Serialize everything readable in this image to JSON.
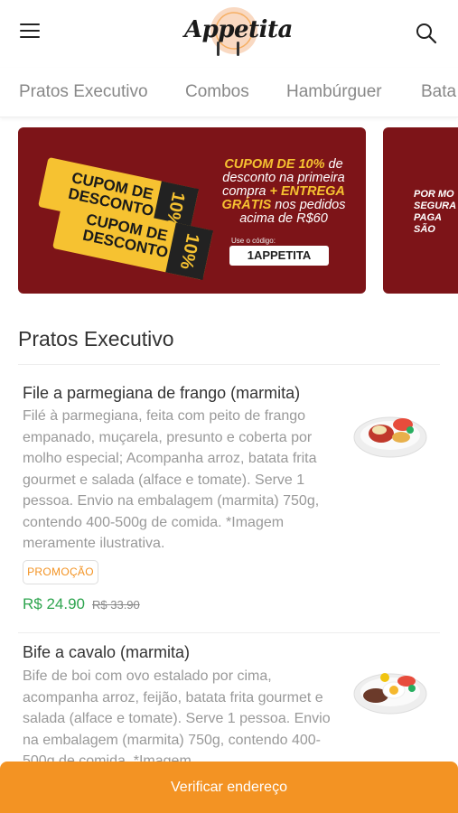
{
  "app": {
    "logo_text": "Appetita"
  },
  "tabs": [
    "Pratos Executivo",
    "Combos",
    "Hambúrguer",
    "Bata"
  ],
  "banner": {
    "coupon_label_line1": "CUPOM DE",
    "coupon_label_line2": "DESCONTO",
    "coupon_percent": "10%",
    "promo_line1": "CUPOM DE 10%",
    "promo_line1_rest": " de",
    "promo_line2": "desconto na primeira",
    "promo_line3a": "compra ",
    "promo_line3b": "+ ENTREGA",
    "promo_line4a": "GRÁTIS",
    "promo_line4b": " nos pedidos",
    "promo_line5": "acima de R$60",
    "code_label": "Use o código:",
    "code": "1APPETITA"
  },
  "banner2": {
    "line1": "POR MO",
    "line2": "SEGURA",
    "line3": "PAGA",
    "line4": "SÃO"
  },
  "section": {
    "title": "Pratos Executivo"
  },
  "products": [
    {
      "name": "File a parmegiana de frango (marmita)",
      "description": "Filé à parmegiana, feita com peito de frango empanado, muçarela, presunto e coberta por molho especial; Acompanha arroz, batata frita gourmet e salada (alface e tomate). Serve 1 pessoa. Envio na embalagem (marmita) 750g, contendo 400-500g de comida. *Imagem meramente ilustrativa.",
      "badge": "PROMOÇÃO",
      "price": "R$ 24.90",
      "old_price": "R$ 33.90"
    },
    {
      "name": "Bife a cavalo (marmita)",
      "description": "Bife de boi com ovo estalado por cima, acompanha arroz, feijão, batata frita gourmet e salada (alface e tomate). Serve 1 pessoa. Envio na embalagem (marmita) 750g, contendo 400-500g de comida. *Imagem"
    }
  ],
  "cta": {
    "label": "Verificar endereço"
  },
  "colors": {
    "accent": "#f39323",
    "price": "#2da44e",
    "banner_bg": "#7d1418",
    "coupon": "#f6c231"
  },
  "icons": {
    "menu": "hamburger-menu-icon",
    "search": "search-icon"
  }
}
